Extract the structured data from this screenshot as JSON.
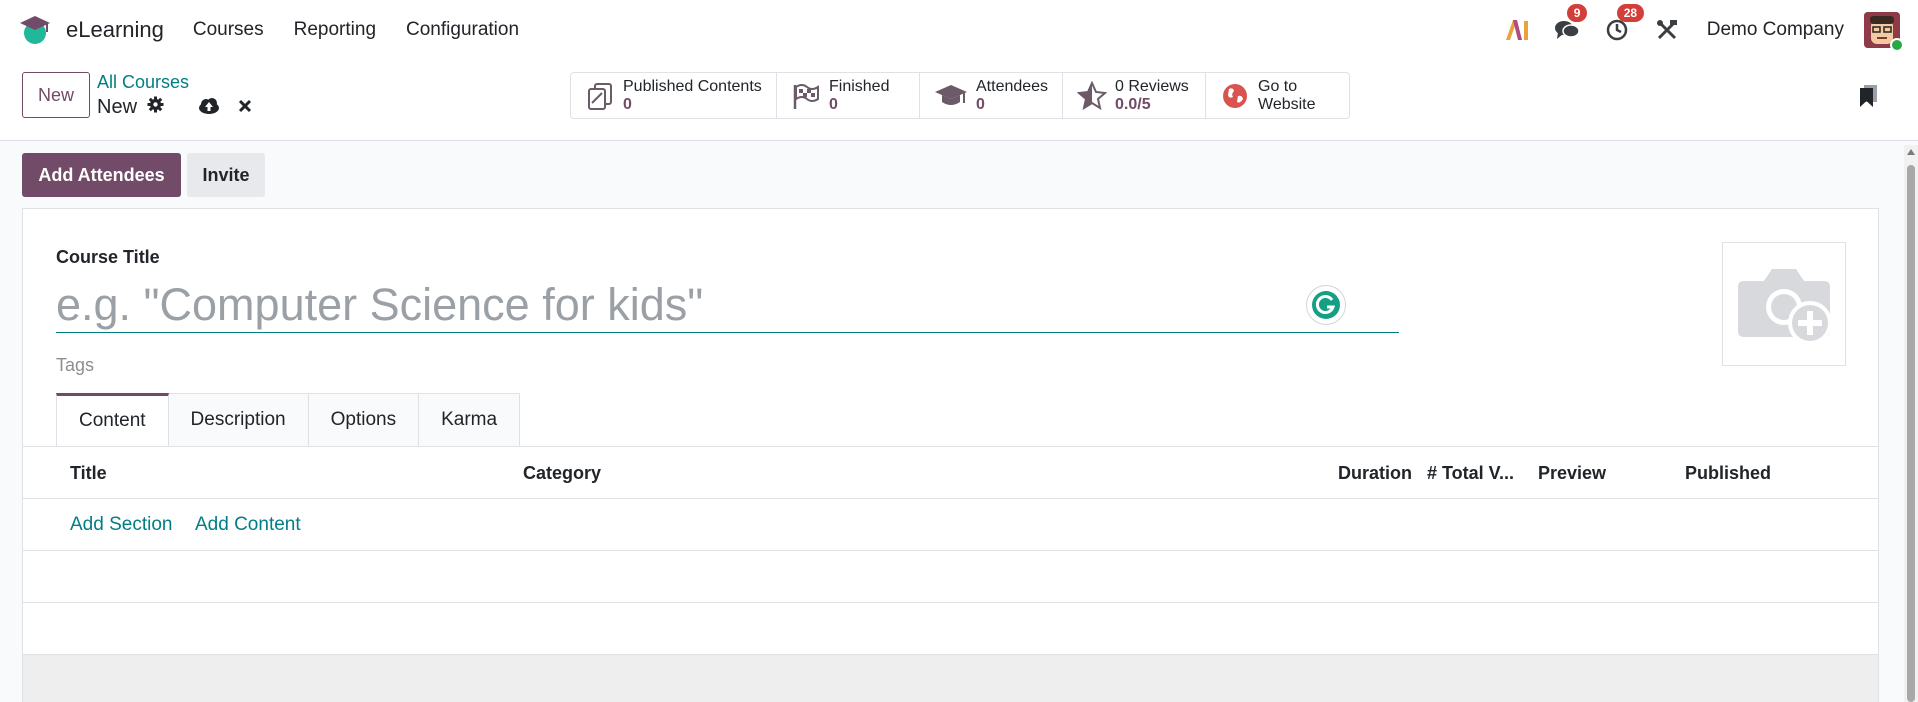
{
  "navbar": {
    "app_name": "eLearning",
    "menu": [
      "Courses",
      "Reporting",
      "Configuration"
    ],
    "messages_badge": "9",
    "activities_badge": "28",
    "company": "Demo Company"
  },
  "control_panel": {
    "new_label": "New",
    "breadcrumb_parent": "All Courses",
    "breadcrumb_current": "New",
    "stats": [
      {
        "label": "Published Contents",
        "value": "0",
        "icon": "documents-icon"
      },
      {
        "label": "Finished",
        "value": "0",
        "icon": "flag-icon"
      },
      {
        "label": "Attendees",
        "value": "0",
        "icon": "graduation-cap-icon"
      },
      {
        "label": "0 Reviews",
        "value": "0.0/5",
        "icon": "star-icon"
      },
      {
        "label": "Go to",
        "value": "Website",
        "icon": "globe-icon"
      }
    ]
  },
  "actions": {
    "add_attendees": "Add Attendees",
    "invite": "Invite"
  },
  "form": {
    "course_title_label": "Course Title",
    "course_title_placeholder": "e.g. \"Computer Science for kids\"",
    "course_title_value": "",
    "tags_placeholder": "Tags",
    "tabs": [
      "Content",
      "Description",
      "Options",
      "Karma"
    ],
    "active_tab": "Content",
    "table_columns": [
      "Title",
      "Category",
      "Duration",
      "# Total V...",
      "Preview",
      "Published"
    ],
    "add_section": "Add Section",
    "add_content": "Add Content"
  },
  "colors": {
    "brand": "#714b67",
    "link": "#017e84",
    "badge": "#d23f3a"
  }
}
